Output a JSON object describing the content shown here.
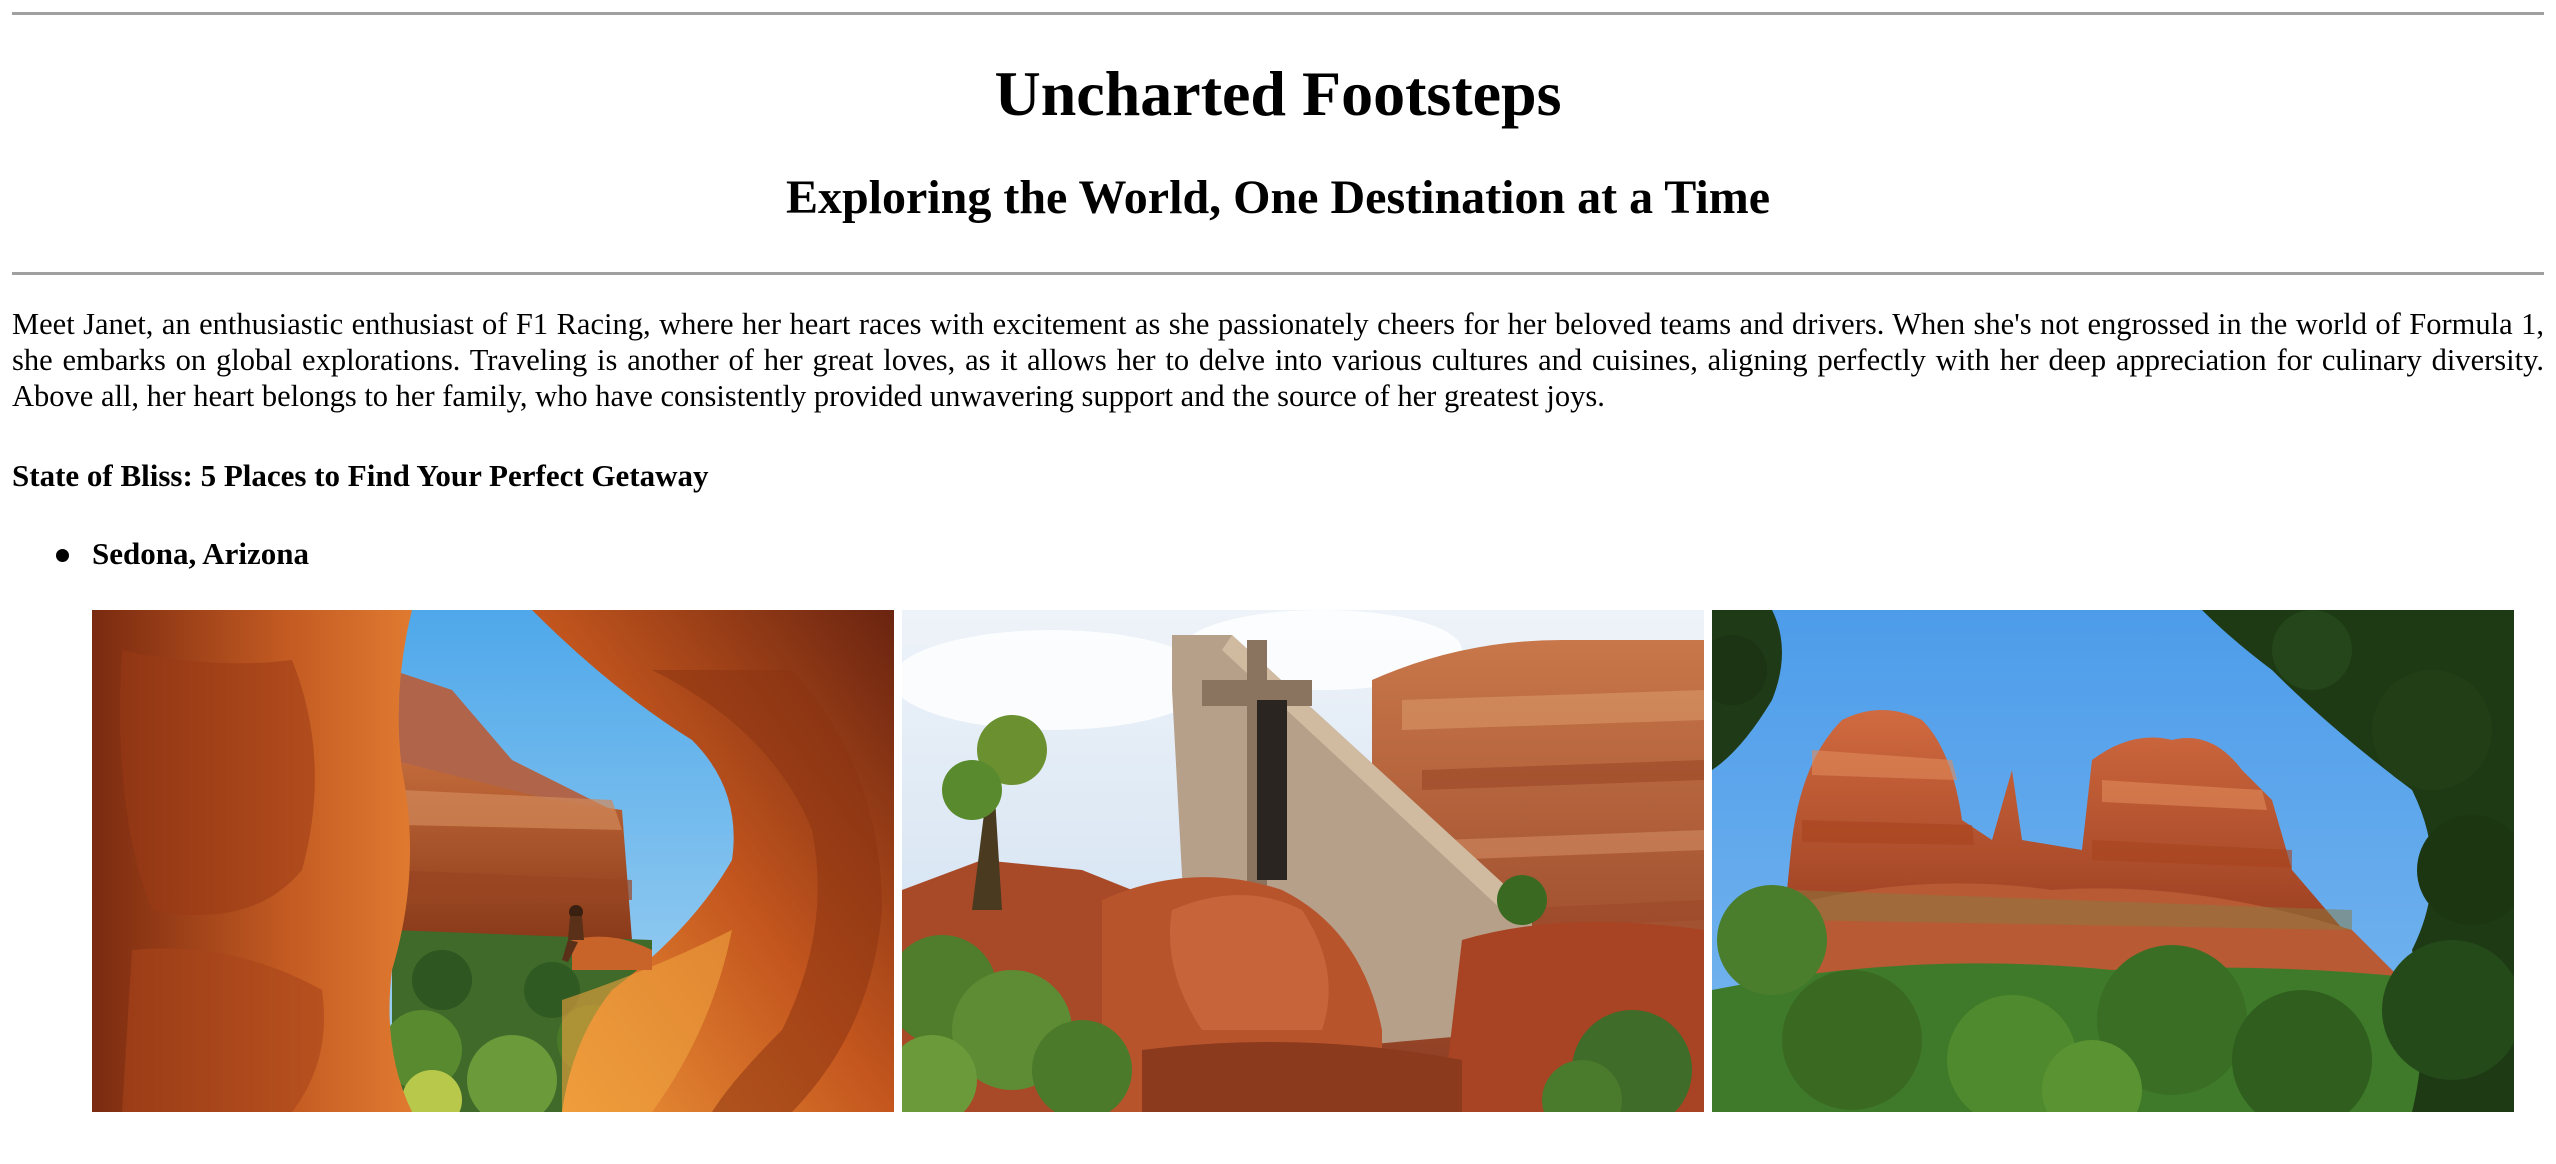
{
  "header": {
    "title": "Uncharted Footsteps",
    "subtitle": "Exploring the World, One Destination at a Time"
  },
  "intro": {
    "text": "Meet Janet, an enthusiastic enthusiast of F1 Racing, where her heart races with excitement as she passionately cheers for her beloved teams and drivers. When she's not engrossed in the world of Formula 1, she embarks on global explorations. Traveling is another of her great loves, as it allows her to delve into various cultures and cuisines, aligning perfectly with her deep appreciation for culinary diversity. Above all, her heart belongs to her family, who have consistently provided unwavering support and the source of her greatest joys."
  },
  "article": {
    "heading": "State of Bliss: 5 Places to Find Your Perfect Getaway",
    "destinations": [
      {
        "name": "Sedona, Arizona",
        "photos": [
          "red-rock-cave-photo",
          "chapel-of-the-holy-cross-photo",
          "cathedral-rock-photo"
        ]
      }
    ]
  },
  "colors": {
    "rule": "#a0a0a0",
    "red_rock": "#b8502a",
    "sky": "#5aa8ec",
    "foliage": "#3f7a2e"
  }
}
